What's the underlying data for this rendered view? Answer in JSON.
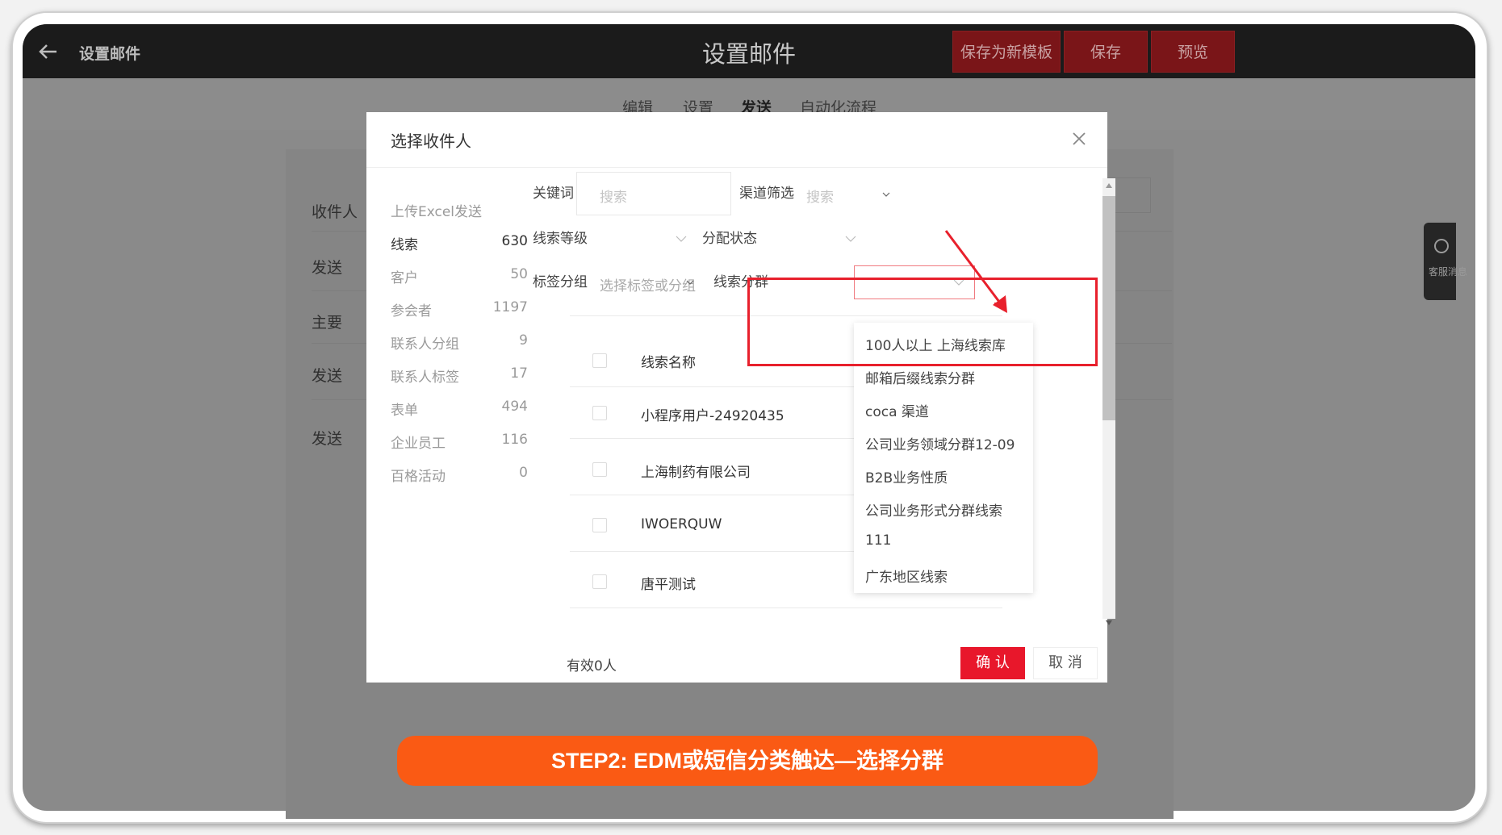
{
  "header": {
    "app_title": "设置邮件",
    "page_title": "设置邮件",
    "save_as_template": "保存为新模板",
    "save": "保存",
    "preview": "预览"
  },
  "tabs": [
    "编辑",
    "设置",
    "发送",
    "自动化流程"
  ],
  "active_tab": "发送",
  "background_labels": [
    "收件人",
    "发送",
    "主要",
    "发送",
    "发送"
  ],
  "chat_widget": {
    "label": "客服消息"
  },
  "modal": {
    "title": "选择收件人",
    "sidebar": [
      {
        "label": "上传Excel发送",
        "count": ""
      },
      {
        "label": "线索",
        "count": "630"
      },
      {
        "label": "客户",
        "count": "50"
      },
      {
        "label": "参会者",
        "count": "1197"
      },
      {
        "label": "联系人分组",
        "count": "9"
      },
      {
        "label": "联系人标签",
        "count": "17"
      },
      {
        "label": "表单",
        "count": "494"
      },
      {
        "label": "企业员工",
        "count": "116"
      },
      {
        "label": "百格活动",
        "count": "0"
      }
    ],
    "filters": {
      "keyword_label": "关键词",
      "keyword_placeholder": "搜索",
      "channel_label": "渠道筛选",
      "channel_placeholder": "搜索",
      "level_label": "线索等级",
      "assign_label": "分配状态",
      "tag_label": "标签分组",
      "tag_placeholder": "选择标签或分组",
      "segment_label": "线索分群"
    },
    "table": {
      "header": "线索名称",
      "rows": [
        "小程序用户-24920435",
        "上海制药有限公司",
        "IWOERQUW",
        "唐平测试"
      ]
    },
    "segment_options": [
      "100人以上 上海线索库",
      "邮箱后缀线索分群",
      "coca 渠道",
      "公司业务领域分群12-09",
      "B2B业务性质",
      "公司业务形式分群线索",
      "111",
      "广东地区线索"
    ],
    "footer": {
      "valid_count": "有效0人",
      "confirm": "确 认",
      "cancel": "取 消"
    }
  },
  "banner": "STEP2:   EDM或短信分类触达—选择分群",
  "colors": {
    "confirm_red": "#e8172b",
    "banner_orange": "#fa5a14",
    "highlight_red": "#e8202c"
  }
}
